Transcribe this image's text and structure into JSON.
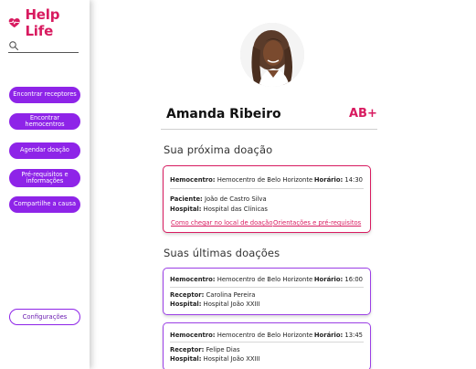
{
  "brand": {
    "name": "Help Life",
    "accent": "#d81b60"
  },
  "sidebar": {
    "search_placeholder": "",
    "items": [
      {
        "label": "Encontrar receptores"
      },
      {
        "label": "Encontrar hemocentros"
      },
      {
        "label": "Agendar doação"
      },
      {
        "label": "Pré-requisitos e informações"
      },
      {
        "label": "Compartilhe a causa"
      }
    ],
    "settings_label": "Configurações",
    "button_color": "#8e24e8"
  },
  "profile": {
    "name": "Amanda Ribeiro",
    "blood_type": "AB+"
  },
  "next_donation": {
    "title": "Sua próxima doação",
    "hemocentro_label": "Hemocentro:",
    "hemocentro": "Hemocentro de Belo Horizonte",
    "horario_label": "Horário:",
    "horario": "14:30",
    "paciente_label": "Paciente:",
    "paciente": "João de Castro Silva",
    "hospital_label": "Hospital:",
    "hospital": "Hospital das Clínicas",
    "link_directions": "Como chegar no local de doação",
    "link_guidelines": "Orientações e pré-requisitos"
  },
  "past_donations": {
    "title": "Suas últimas doações",
    "items": [
      {
        "hemocentro_label": "Hemocentro:",
        "hemocentro": "Hemocentro de Belo Horizonte",
        "horario_label": "Horário:",
        "horario": "16:00",
        "receptor_label": "Receptor:",
        "receptor": "Carolina Pereira",
        "hospital_label": "Hospital:",
        "hospital": "Hospital João XXIII"
      },
      {
        "hemocentro_label": "Hemocentro:",
        "hemocentro": "Hemocentro de Belo Horizonte",
        "horario_label": "Horário:",
        "horario": "13:45",
        "receptor_label": "Receptor:",
        "receptor": "Felipe Dias",
        "hospital_label": "Hospital:",
        "hospital": "Hospital João XXIII"
      }
    ]
  }
}
